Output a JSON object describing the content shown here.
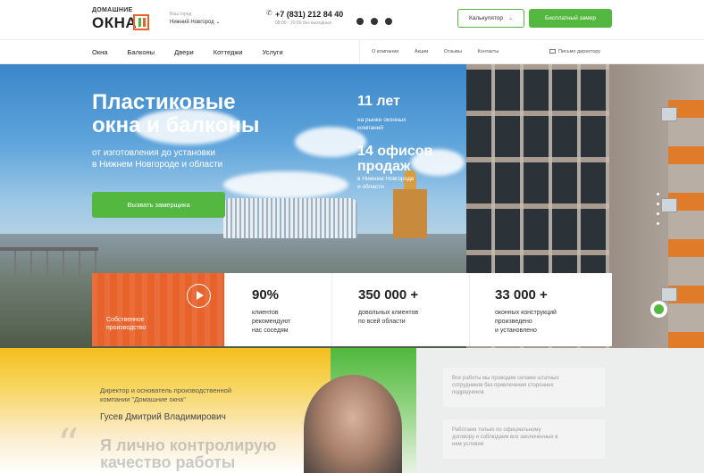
{
  "header": {
    "logo_line1": "ДОМАШНИЕ",
    "logo_line2": "ОКНА",
    "city_caption": "Ваш город",
    "city_value": "Нижний Новгород",
    "phone": "+7 (831) 212 84 40",
    "hours": "08:00 - 20:00 без выходных",
    "calc_label": "Калькулятор",
    "measure_label": "Бесплатный замер"
  },
  "nav": {
    "main": [
      "Окна",
      "Балконы",
      "Двери",
      "Коттеджи",
      "Услуги"
    ],
    "secondary": [
      "О компании",
      "Акции",
      "Отзывы",
      "Контакты"
    ],
    "letter": "Письмо директору"
  },
  "hero": {
    "title_line1": "Пластиковые",
    "title_line2": "окна и балконы",
    "subtitle_line1": "от изготовления до установки",
    "subtitle_line2": "в Нижнем Новгороде и области",
    "cta": "Вызвать замерщика",
    "stat1_big": "11 лет",
    "stat1_small_line1": "на рынке оконных",
    "stat1_small_line2": "компаний",
    "stat2_big_line1": "14 офисов",
    "stat2_big_line2": "продаж",
    "stat2_small_line1": "в Нижнем Новгороде",
    "stat2_small_line2": "и области"
  },
  "stats": {
    "production_line1": "Собственное",
    "production_line2": "производство",
    "items": [
      {
        "value": "90%",
        "line1": "клиентов",
        "line2": "рекомендуют",
        "line3": "нас соседям"
      },
      {
        "value": "350 000 +",
        "line1": "довольных клиентов",
        "line2": "по всей области",
        "line3": ""
      },
      {
        "value": "33 000 +",
        "line1": "оконных конструкций",
        "line2": "произведено",
        "line3": "и установлено"
      }
    ]
  },
  "director": {
    "role_line1": "Директор и основатель производственной",
    "role_line2": "компании \"Домашние окна\"",
    "name": "Гусев Дмитрий Владимирович",
    "quote_line1": "Я лично контролирую",
    "quote_line2": "качество работы"
  },
  "cards": [
    {
      "line1": "Все работы мы проводим силами штатных",
      "line2": "сотрудников без привлечения сторонних",
      "line3": "подрядчиков"
    },
    {
      "line1": "Работаем только по официальному",
      "line2": "договору и соблюдаем все заключенные в",
      "line3": "нем условия"
    }
  ],
  "colors": {
    "accent_green": "#54b840",
    "accent_orange": "#e8622b"
  }
}
